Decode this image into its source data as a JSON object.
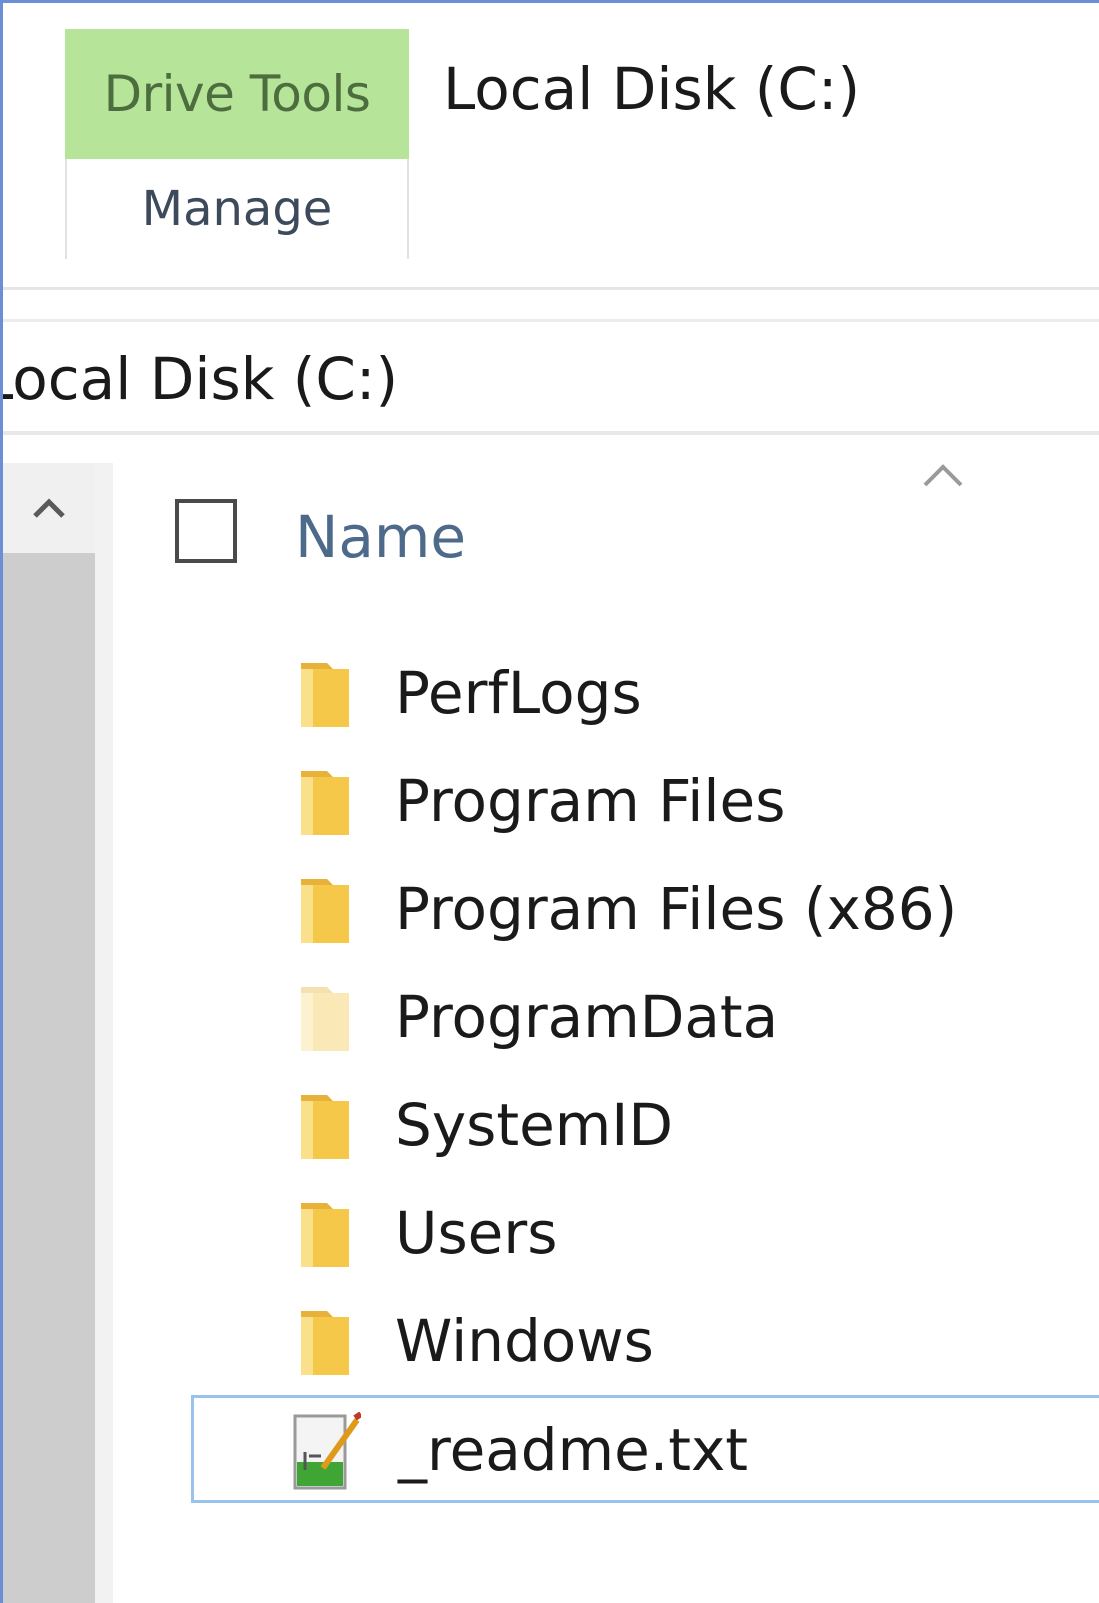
{
  "ribbon": {
    "context_tab_group": "Drive Tools",
    "context_tab": "Manage"
  },
  "window": {
    "title": "Local Disk (C:)"
  },
  "address": {
    "path_text": "Local Disk (C:)"
  },
  "file_list": {
    "column_name": "Name",
    "items": [
      {
        "name": "PerfLogs",
        "type": "folder",
        "icon": "folder-icon"
      },
      {
        "name": "Program Files",
        "type": "folder",
        "icon": "folder-icon"
      },
      {
        "name": "Program Files (x86)",
        "type": "folder",
        "icon": "folder-icon"
      },
      {
        "name": "ProgramData",
        "type": "folder",
        "hidden": true,
        "icon": "folder-icon"
      },
      {
        "name": "SystemID",
        "type": "folder",
        "icon": "folder-icon"
      },
      {
        "name": "Users",
        "type": "folder",
        "icon": "folder-icon"
      },
      {
        "name": "Windows",
        "type": "folder",
        "icon": "folder-icon"
      },
      {
        "name": "_readme.txt",
        "type": "file",
        "selected": true,
        "icon": "text-file-icon"
      }
    ]
  },
  "colors": {
    "context_tab_bg": "#b6e59a",
    "selection_border": "#99c3ec",
    "folder_yellow": "#f5c84a",
    "header_text": "#4e6a8a"
  }
}
